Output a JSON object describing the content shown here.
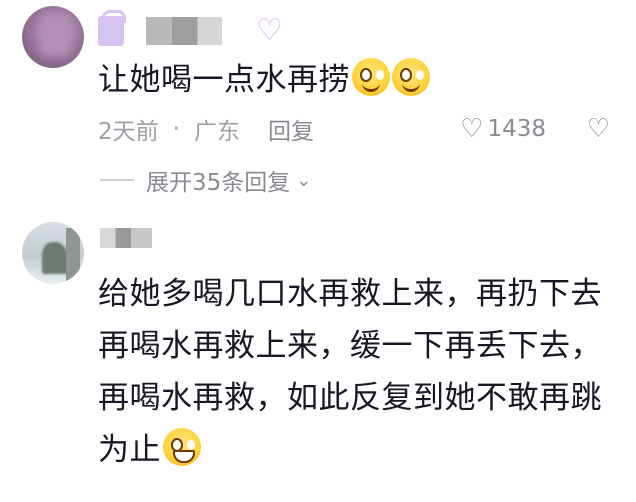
{
  "comments": [
    {
      "text": "让她喝一点水再捞",
      "date": "2天前",
      "location": "广东",
      "reply_label": "回复",
      "likes": "1438",
      "expand_replies": "展开35条回复"
    },
    {
      "text": "给她多喝几口水再救上来，再扔下去再喝水再救上来，缓一下再丢下去，再喝水再救，如此反复到她不敢再跳为止"
    }
  ],
  "icons": {
    "heart": "heart-outline-icon",
    "dislike": "broken-heart-icon",
    "chevron": "chevron-down-icon"
  },
  "colors": {
    "text": "#161823",
    "meta": "#9fa1a7",
    "deco_purple": "#d8c3f0"
  }
}
